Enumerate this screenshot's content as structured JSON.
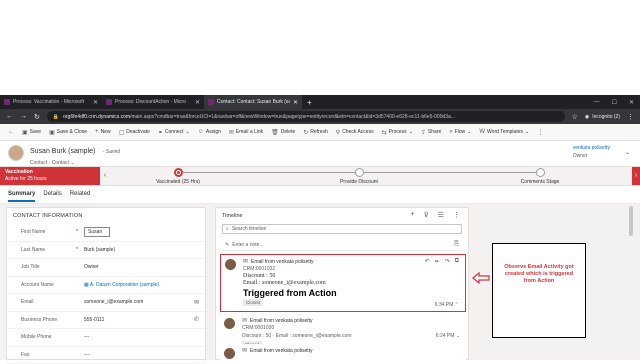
{
  "browser": {
    "tabs": [
      {
        "label": "Process: Vaccination - Microsoft",
        "active": false
      },
      {
        "label": "Process: DiscountAction - Micro",
        "active": false
      },
      {
        "label": "Contact: Contact: Susan Burk (sa",
        "active": true
      }
    ],
    "url_host": "org6fe4df0.crm.dynamics.com",
    "url_path": "/main.aspx?cmdbar=true&forceUCI=1&navbar=off&newWindow=true&pagetype=entityrecord&etn=contact&id=3d57400-e628-ec11-b6e5-000d3a...",
    "incognito_label": "Incognito (2)"
  },
  "commandbar": {
    "items": [
      "Save",
      "Save & Close",
      "New",
      "Deactivate",
      "Connect",
      "Assign",
      "Email a Link",
      "Delete",
      "Refresh",
      "Check Access",
      "Process",
      "Share",
      "Flow",
      "Word Templates"
    ]
  },
  "record": {
    "name": "Susan Burk (sample)",
    "saved": "- Saved",
    "entity": "Contact",
    "form": "Contact",
    "owner_name": "venkata polisetty",
    "owner_label": "Owner"
  },
  "bpf": {
    "active_title": "Vaccination",
    "active_sub": "Active for 25 hours",
    "stages": [
      {
        "name": "Vaccinated (25 Hrs)",
        "current": true
      },
      {
        "name": "Provide Discount",
        "current": false
      },
      {
        "name": "Comments Stage",
        "current": false
      }
    ]
  },
  "formtabs": [
    "Summary",
    "Details",
    "Related"
  ],
  "contact": {
    "section_title": "CONTACT INFORMATION",
    "fields": [
      {
        "label": "First Name",
        "required": true,
        "value": "Susan",
        "style": "box"
      },
      {
        "label": "Last Name",
        "required": true,
        "value": "Burk (sample)",
        "style": "text"
      },
      {
        "label": "Job Title",
        "required": false,
        "value": "Owner",
        "style": "text"
      },
      {
        "label": "Account Name",
        "required": false,
        "value": "A. Datum Corporation (sample)",
        "style": "link"
      },
      {
        "label": "Email",
        "required": false,
        "value": "someone_i@example.com",
        "style": "text"
      },
      {
        "label": "Business Phone",
        "required": false,
        "value": "555-0111",
        "style": "text"
      },
      {
        "label": "Mobile Phone",
        "required": false,
        "value": "---",
        "style": "text"
      },
      {
        "label": "Fax",
        "required": false,
        "value": "---",
        "style": "text"
      }
    ]
  },
  "timeline": {
    "title": "Timeline",
    "search_placeholder": "Search timeline",
    "note_placeholder": "Enter a note...",
    "activities": [
      {
        "title": "Email from venkata polisetty",
        "lines": [
          "CRM:0001032"
        ],
        "serif_lines": [
          "Discount : 50",
          "Email : someone_i@example.com"
        ],
        "big": "Triggered from Action",
        "badge": "Closed",
        "time": "6:34 PM"
      },
      {
        "title": "Email from venkata polisetty",
        "lines": [
          "CRM:0001030",
          "Discount : 50 · Email : someone_i@example.com"
        ],
        "badge": "Closed",
        "time": "6:24 PM"
      },
      {
        "title": "Email from venkata polisetty",
        "lines": [],
        "badge": "",
        "time": ""
      }
    ]
  },
  "annotation": {
    "text": "Observe Email Activity got created which is triggered from Action",
    "color": "#d13438"
  }
}
